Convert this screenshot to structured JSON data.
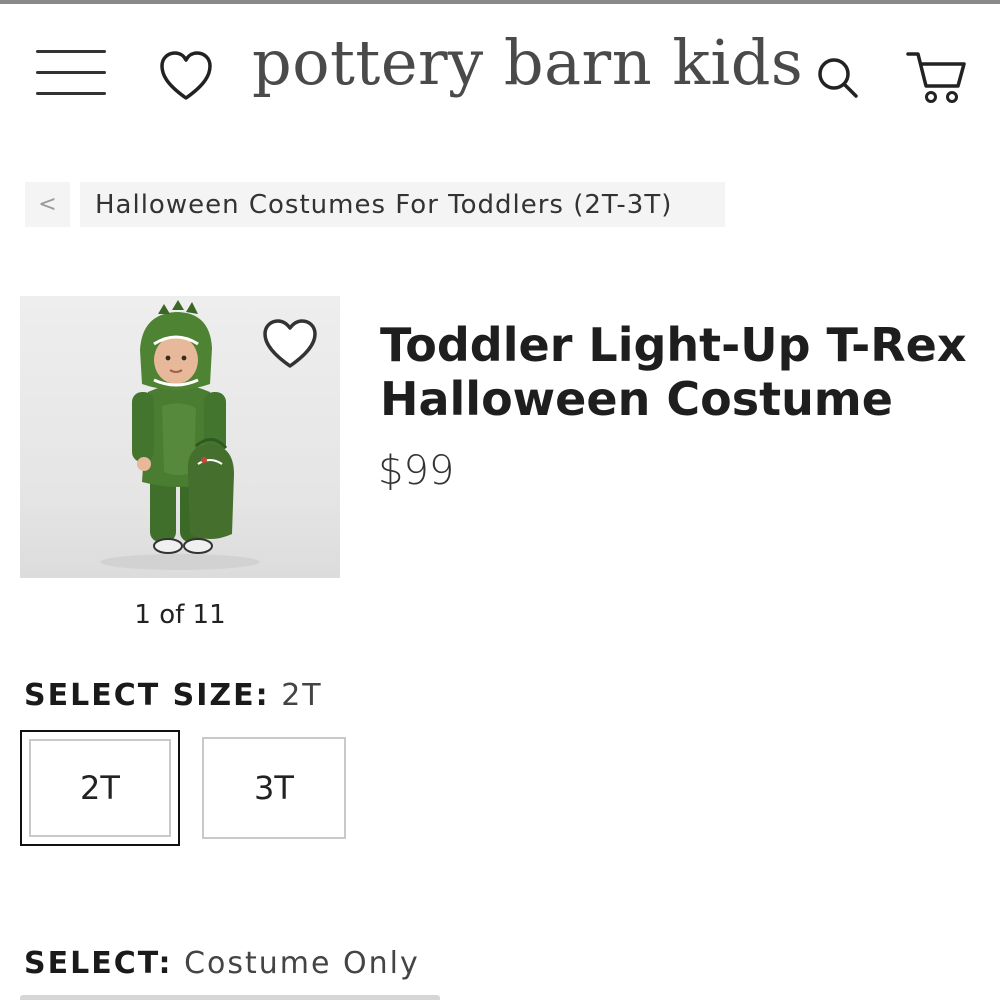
{
  "header": {
    "logo_text": "pottery barn kids",
    "icons": {
      "menu": "hamburger-menu-icon",
      "favorites": "heart-icon",
      "search": "search-icon",
      "cart": "cart-icon"
    }
  },
  "breadcrumb": {
    "back_label": "<",
    "label": "Halloween Costumes For Toddlers (2T-3T)"
  },
  "product": {
    "title": "Toddler Light-Up T-Rex Halloween Costume",
    "price": "$99",
    "image_counter": "1 of 11"
  },
  "size": {
    "label": "SELECT SIZE:",
    "selected_value": "2T",
    "options": [
      "2T",
      "3T"
    ]
  },
  "option": {
    "label": "SELECT:",
    "selected_value": "Costume Only"
  },
  "colors": {
    "text": "#222222",
    "chip_background": "#f4f4f4",
    "selected_border": "#111111",
    "costume_green": "#3f6f2a"
  }
}
